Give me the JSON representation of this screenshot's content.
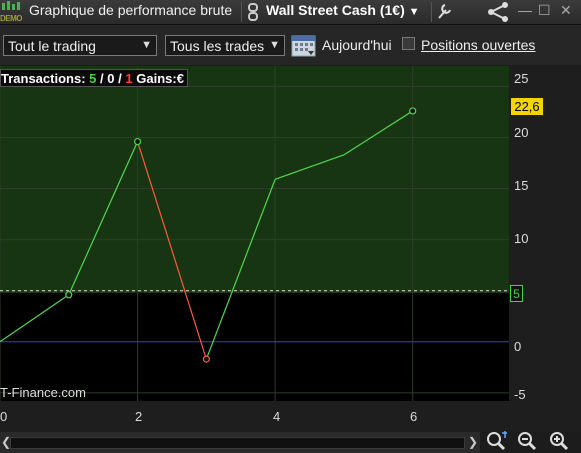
{
  "window": {
    "title": "Graphique de performance brute",
    "demo_badge": "DEMO",
    "instrument": "Wall Street Cash (1€)"
  },
  "toolbar": {
    "period_select": "Tout le trading",
    "trades_select": "Tous les trades",
    "today_label": "Aujourd'hui",
    "open_positions_label": "Positions ouvertes",
    "open_positions_checked": false
  },
  "info": {
    "transactions_label": "Transactions:",
    "wins": "5",
    "sep1": "/",
    "neutral": "0",
    "sep2": "/",
    "losses": "1",
    "gains_label": "Gains:",
    "gains_unit": "€"
  },
  "watermark": "T-Finance.com",
  "colors": {
    "profit_fill": "#173512",
    "gain_line": "#4fd84f",
    "loss_line": "#ff5a3c",
    "baseline": "#2a35c8",
    "last_value_badge": "#f3d400"
  },
  "chart_data": {
    "type": "line",
    "x": [
      0,
      1,
      2,
      3,
      4,
      5,
      6
    ],
    "y": [
      0,
      4.6,
      19.6,
      -1.7,
      15.9,
      18.3,
      22.6
    ],
    "segment_colors": [
      "gain",
      "gain",
      "loss",
      "gain",
      "gain",
      "gain"
    ],
    "markers_at": [
      1,
      2,
      3,
      6
    ],
    "x_ticks": [
      "0",
      "2",
      "4",
      "6"
    ],
    "y_ticks": [
      "25",
      "20",
      "15",
      "10",
      "5",
      "0",
      "-5"
    ],
    "ylim": [
      -5.8,
      27
    ],
    "xlim": [
      0,
      7.4
    ],
    "reference_level": 5,
    "reference_label": "5",
    "last_value": "22,6",
    "baseline_value": 0,
    "grid": true
  }
}
